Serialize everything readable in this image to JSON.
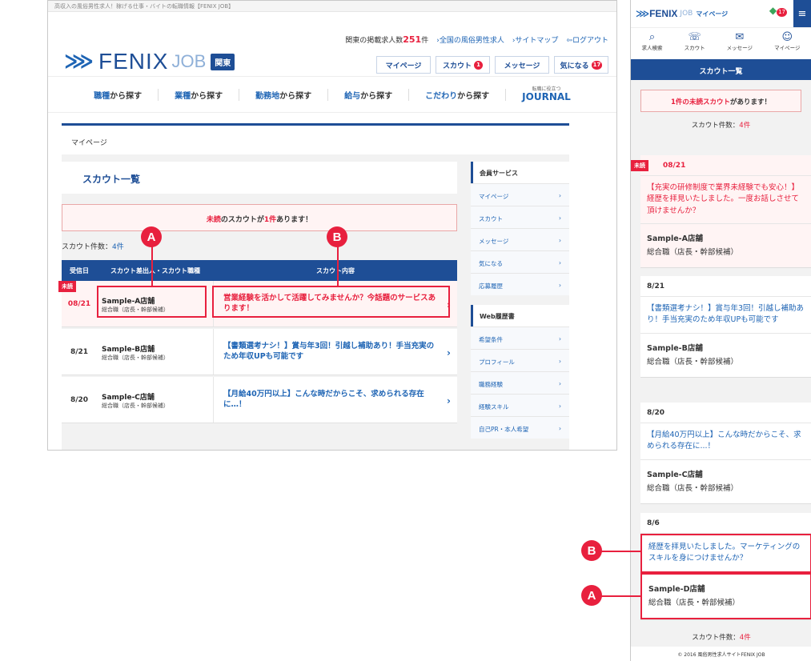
{
  "desktop": {
    "tagline": "高収入の風俗男性求人！稼げる仕事・バイトの転職情報【FENIX JOB】",
    "logo": {
      "brand": "FENIX",
      "sub": "JOB",
      "region": "関東"
    },
    "toplinks": {
      "count_prefix": "関東の掲載求人数",
      "count_value": "251",
      "count_suffix": "件",
      "link1": "›全国の風俗男性求人",
      "link2": "›サイトマップ",
      "link3": "ログアウト"
    },
    "navbtns": {
      "mypage": "マイページ",
      "scout": "スカウト",
      "scout_badge": "1",
      "message": "メッセージ",
      "favorite": "気になる",
      "favorite_badge": "17"
    },
    "catnav": [
      {
        "strong": "職種",
        "rest": "から探す"
      },
      {
        "strong": "業種",
        "rest": "から探す"
      },
      {
        "strong": "勤務地",
        "rest": "から探す"
      },
      {
        "strong": "給与",
        "rest": "から探す"
      },
      {
        "strong": "こだわり",
        "rest": "から探す"
      }
    ],
    "journal": {
      "small": "転職に役立つ",
      "label": "JOURNAL"
    },
    "breadcrumb": "マイページ",
    "page_title": "スカウト一覧",
    "notice": {
      "red1": "未読",
      "mid": "のスカウトが",
      "red2": "1件",
      "end": "あります！"
    },
    "count": {
      "label": "スカウト件数：",
      "value": "4件"
    },
    "table_header": {
      "date": "受信日",
      "company": "スカウト差出人・スカウト職種",
      "content": "スカウト内容"
    },
    "rows": [
      {
        "date": "08/21",
        "company": "Sample-A店舗",
        "job": "総合職（店長・幹部候補）",
        "message": "営業経験を活かして活躍してみませんか？今話題のサービスあります！",
        "ribbon": "未読"
      },
      {
        "date": "8/21",
        "company": "Sample-B店舗",
        "job": "総合職（店長・幹部候補）",
        "message": "【書類選考ナシ！】賞与年3回！引越し補助あり！手当充実のため年収UPも可能です"
      },
      {
        "date": "8/20",
        "company": "Sample-C店舗",
        "job": "総合職（店長・幹部候補）",
        "message": "【月給40万円以上】こんな時だからこそ、求められる存在に…！"
      }
    ],
    "side_services": {
      "head": "会員サービス",
      "items": [
        "マイページ",
        "スカウト",
        "メッセージ",
        "気になる",
        "応募履歴"
      ]
    },
    "side_web": {
      "head": "Web履歴書",
      "items": [
        "希望条件",
        "プロフィール",
        "職務経験",
        "経験スキル",
        "自己PR・本人希望"
      ]
    },
    "labels": {
      "a": "A",
      "b": "B"
    }
  },
  "mobile": {
    "logo": {
      "brand": "FENIX",
      "sub": "JOB",
      "mypage": "マイページ"
    },
    "gem_badge": "17",
    "icons": [
      {
        "icon": "search-icon",
        "label": "求人検索"
      },
      {
        "icon": "scout-icon",
        "label": "スカウト"
      },
      {
        "icon": "message-icon",
        "label": "メッセージ"
      },
      {
        "icon": "user-icon",
        "label": "マイページ"
      }
    ],
    "title": "スカウト一覧",
    "notice": {
      "red1": "1件の",
      "red2": "未読スカウト",
      "end": "があります！"
    },
    "count": {
      "label": "スカウト件数：",
      "value": "4件"
    },
    "cards": [
      {
        "date": "08/21",
        "ribbon": "未読",
        "message": "【充実の研修制度で業界未経験でも安心！】経歴を拝見いたしました。一度お話しさせて頂けませんか？",
        "company": "Sample-A店舗",
        "job": "総合職（店長・幹部候補）"
      },
      {
        "date": "8/21",
        "message": "【書類選考ナシ！】賞与年3回！引越し補助あり！手当充実のため年収UPも可能です",
        "company": "Sample-B店舗",
        "job": "総合職（店長・幹部候補）"
      },
      {
        "date": "8/20",
        "message": "【月給40万円以上】こんな時だからこそ、求められる存在に...！",
        "company": "Sample-C店舗",
        "job": "総合職（店長・幹部候補）"
      },
      {
        "date": "8/6",
        "message": "経歴を拝見いたしました。マーケティングのスキルを身につけませんか？",
        "company": "Sample-D店舗",
        "job": "総合職（店長・幹部候補）"
      }
    ],
    "footer": "© 2016 風俗男性求人サイトFENIX JOB",
    "labels": {
      "a": "A",
      "b": "B"
    }
  }
}
